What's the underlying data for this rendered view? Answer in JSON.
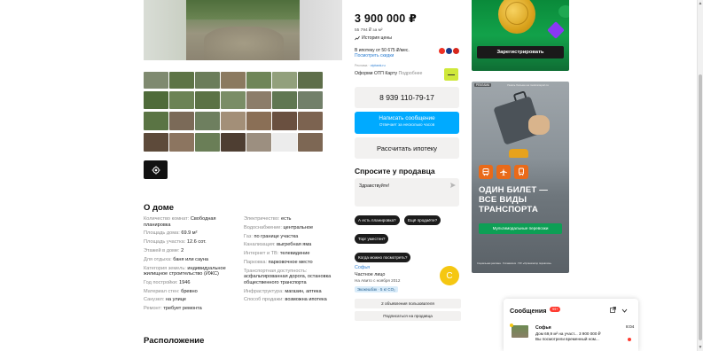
{
  "listing": {
    "price": "3 900 000 ₽",
    "price_per_m2": "55 794 ₽ за м²",
    "price_history": "История цены",
    "mortgage_line": "В ипотеку от 50 675 ₽/мес.",
    "mortgage_link": "Посмотреть скидки",
    "ad_label": "Реклама",
    "ad_advertiser": "otpbank.ru",
    "otp_text": "Оформи ОТП Карту",
    "otp_more": "Подробнее",
    "phone": "8 939 110-79-17",
    "message_btn": "Написать сообщение",
    "message_sub": "Отвечает за несколько часов",
    "calc_btn": "Рассчитать ипотеку"
  },
  "ask": {
    "title": "Спросите у продавца",
    "input_value": "Здравствуйте!",
    "chips": [
      "А есть планировка?",
      "Ещё продаёте?",
      "Торг уместен?",
      "Когда можно посмотреть?"
    ]
  },
  "seller": {
    "name": "Софья",
    "type": "Частное лицо",
    "since": "На Авито с ноября 2012",
    "badge": "Экокешбэк · 5 кг CO₂",
    "avatar_letter": "С",
    "ads_btn": "2 объявления пользователя",
    "subscribe_btn": "Подписаться на продавца"
  },
  "about": {
    "title": "О доме",
    "left": [
      {
        "k": "Количество комнат:",
        "v": "Свободная планировка"
      },
      {
        "k": "Площадь дома:",
        "v": "69.9 м²"
      },
      {
        "k": "Площадь участка:",
        "v": "12.6 сот."
      },
      {
        "k": "Этажей в доме:",
        "v": "2"
      },
      {
        "k": "Для отдыха:",
        "v": "баня или сауна"
      },
      {
        "k": "Категория земель:",
        "v": "индивидуальное жилищное строительство (ИЖС)"
      },
      {
        "k": "Год постройки:",
        "v": "1946"
      },
      {
        "k": "Материал стен:",
        "v": "бревно"
      },
      {
        "k": "Санузел:",
        "v": "на улице"
      },
      {
        "k": "Ремонт:",
        "v": "требует ремонта"
      }
    ],
    "right": [
      {
        "k": "Электричество:",
        "v": "есть"
      },
      {
        "k": "Водоснабжение:",
        "v": "центральное"
      },
      {
        "k": "Газ:",
        "v": "по границе участка"
      },
      {
        "k": "Канализация:",
        "v": "выгребная яма"
      },
      {
        "k": "Интернет и ТВ:",
        "v": "телевидение"
      },
      {
        "k": "Парковка:",
        "v": "парковочное место"
      },
      {
        "k": "Транспортная доступность:",
        "v": "асфальтированная дорога, остановка общественного транспорта"
      },
      {
        "k": "Инфраструктура:",
        "v": "магазин, аптека"
      },
      {
        "k": "Способ продажи:",
        "v": "возможна ипотека"
      }
    ]
  },
  "location_title": "Расположение",
  "ads": {
    "register_btn": "Зарегистрировать",
    "ad2_label": "РЕКЛАМА",
    "ad2_link": "Узнать больше на mostransport.ru",
    "ad2_headline_1": "ОДИН БИЛЕТ —",
    "ad2_headline_2": "ВСЕ ВИДЫ",
    "ad2_headline_3": "ТРАНСПОРТА",
    "ad2_pill": "Мультимодальные перевозки",
    "ad2_foot": "Социальная реклама · Госзаказчик · ГКУ «Организатор перевозок»"
  },
  "messages": {
    "title": "Сообщения",
    "badge": "99+",
    "name": "Софья",
    "time": "8:04",
    "line1": "Дом 69,9 м² на участ... 3 900 000 ₽",
    "line2": "Вы посмотрели временный ном..."
  },
  "icons": {
    "camera": "camera-icon",
    "history": "chart-icon",
    "send": "send-icon",
    "external": "external-link-icon",
    "chevron": "chevron-down-icon"
  },
  "colors": {
    "accent_blue": "#00aaff",
    "link_blue": "#2d7fd3",
    "avatar_yellow": "#f5c712",
    "ad_green": "#12a24a",
    "badge_red": "#ff3b30"
  }
}
